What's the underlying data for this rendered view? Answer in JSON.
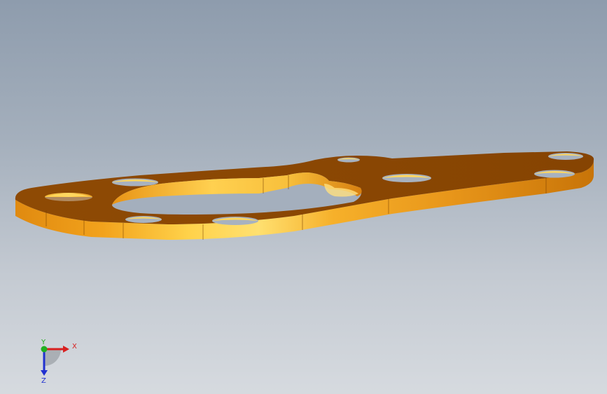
{
  "viewport": {
    "background_top": "#8e9cad",
    "background_bottom": "#d6dadf"
  },
  "model": {
    "name": "flat-plate-bracket",
    "top_face_color": "#8a4703",
    "side_face_color": "#f0a020",
    "highlight_color": "#ffd860",
    "hole_count": 8,
    "center_cutout": "oval"
  },
  "triad": {
    "x_label": "X",
    "y_label": "Y",
    "z_label": "Z",
    "x_color": "#d82020",
    "y_color": "#20b020",
    "z_color": "#2030d0"
  }
}
